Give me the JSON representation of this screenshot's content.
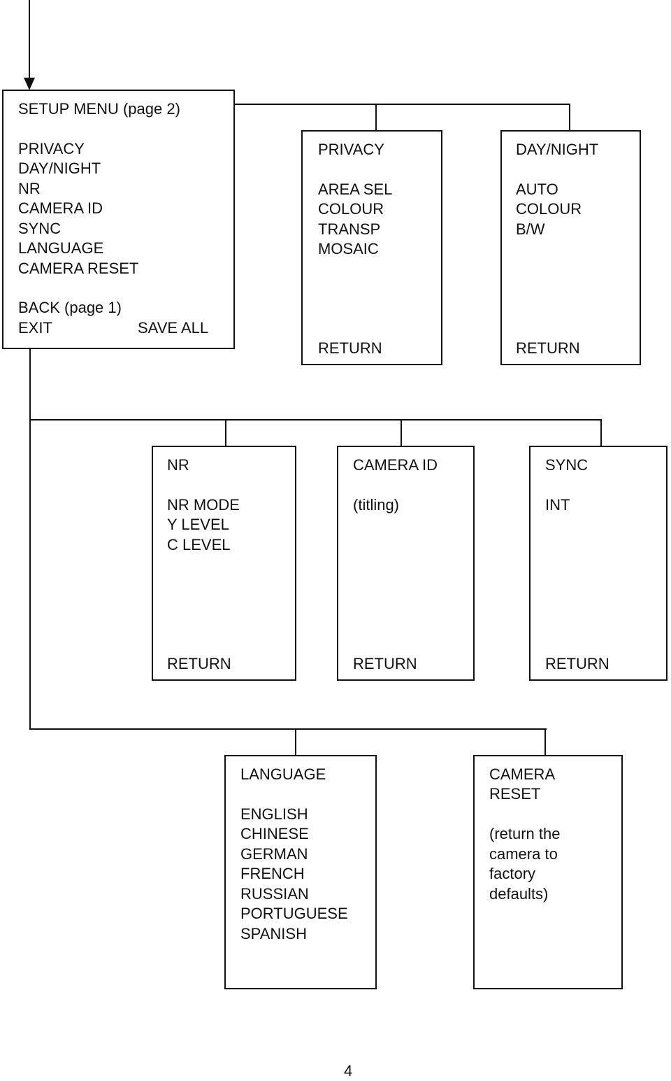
{
  "main_menu": {
    "title": "SETUP MENU (page 2)",
    "items": [
      "PRIVACY",
      "DAY/NIGHT",
      "NR",
      "CAMERA ID",
      "SYNC",
      "LANGUAGE",
      "CAMERA RESET"
    ],
    "back": "BACK (page 1)",
    "exit": "EXIT",
    "save_all": "SAVE ALL"
  },
  "privacy": {
    "title": "PRIVACY",
    "items": [
      "AREA SEL",
      "COLOUR",
      "TRANSP",
      "MOSAIC"
    ],
    "return": "RETURN"
  },
  "day_night": {
    "title": "DAY/NIGHT",
    "items": [
      "AUTO",
      "COLOUR",
      "B/W"
    ],
    "return": "RETURN"
  },
  "nr": {
    "title": "NR",
    "items": [
      "NR MODE",
      "Y LEVEL",
      "C LEVEL"
    ],
    "return": "RETURN"
  },
  "camera_id": {
    "title": "CAMERA ID",
    "items": [
      "(titling)"
    ],
    "return": "RETURN"
  },
  "sync": {
    "title": "SYNC",
    "items": [
      "INT"
    ],
    "return": "RETURN"
  },
  "language": {
    "title": "LANGUAGE",
    "items": [
      "ENGLISH",
      "CHINESE",
      "GERMAN",
      "FRENCH",
      "RUSSIAN",
      "PORTUGUESE",
      "SPANISH"
    ]
  },
  "camera_reset": {
    "title_line1": "CAMERA",
    "title_line2": "RESET",
    "desc": [
      "(return the",
      "camera to",
      "factory",
      "defaults)"
    ]
  },
  "page_number": "4"
}
